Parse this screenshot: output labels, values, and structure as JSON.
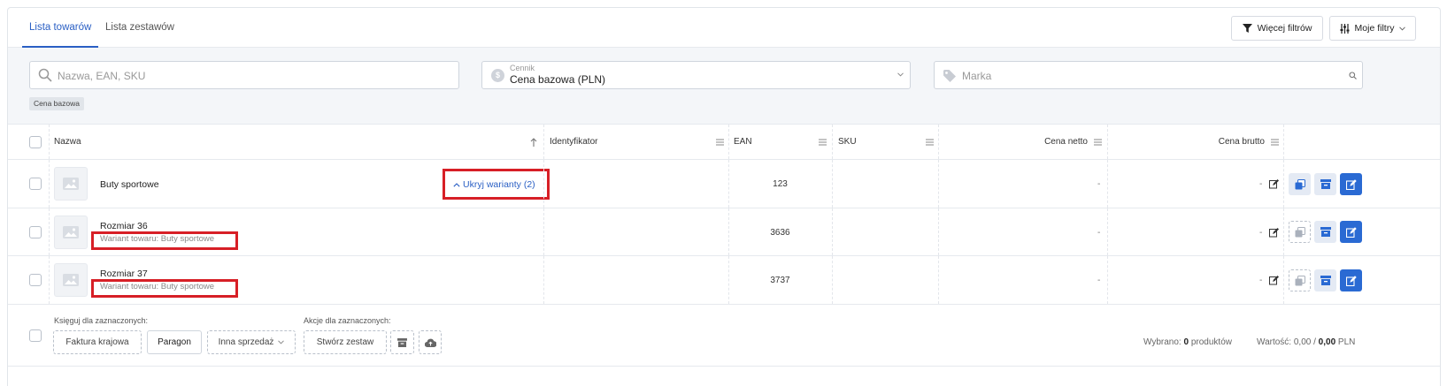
{
  "tabs": [
    {
      "label": "Lista towarów",
      "active": true
    },
    {
      "label": "Lista zestawów",
      "active": false
    }
  ],
  "toolbar": {
    "more_filters": "Więcej filtrów",
    "my_filters": "Moje filtry"
  },
  "filters": {
    "search_placeholder": "Nazwa, EAN, SKU",
    "pricelist_label": "Cennik",
    "pricelist_value": "Cena bazowa (PLN)",
    "brand_placeholder": "Marka",
    "chip": "Cena bazowa"
  },
  "columns": {
    "name": "Nazwa",
    "identifier": "Identyfikator",
    "ean": "EAN",
    "sku": "SKU",
    "net_price": "Cena netto",
    "gross_price": "Cena brutto"
  },
  "rows": [
    {
      "name": "Buty sportowe",
      "toggle": "Ukryj warianty (2)",
      "ean": "123",
      "net": "-",
      "gross": "-"
    },
    {
      "name": "Rozmiar 36",
      "sub": "Wariant towaru: Buty sportowe",
      "ean": "3636",
      "net": "-",
      "gross": "-"
    },
    {
      "name": "Rozmiar 37",
      "sub": "Wariant towaru: Buty sportowe",
      "ean": "3737",
      "net": "-",
      "gross": "-"
    }
  ],
  "footer": {
    "book_label": "Księguj dla zaznaczonych:",
    "invoice": "Faktura krajowa",
    "receipt": "Paragon",
    "other_sale": "Inna sprzedaż",
    "actions_label": "Akcje dla zaznaczonych:",
    "create_set": "Stwórz zestaw",
    "selected_prefix": "Wybrano:",
    "selected_count": "0",
    "selected_suffix": "produktów",
    "value_label": "Wartość:",
    "value_net": "0,00",
    "value_sep": "/",
    "value_gross": "0,00",
    "currency": "PLN"
  },
  "colors": {
    "accent": "#2a6ad3",
    "highlight": "#d71f26"
  }
}
